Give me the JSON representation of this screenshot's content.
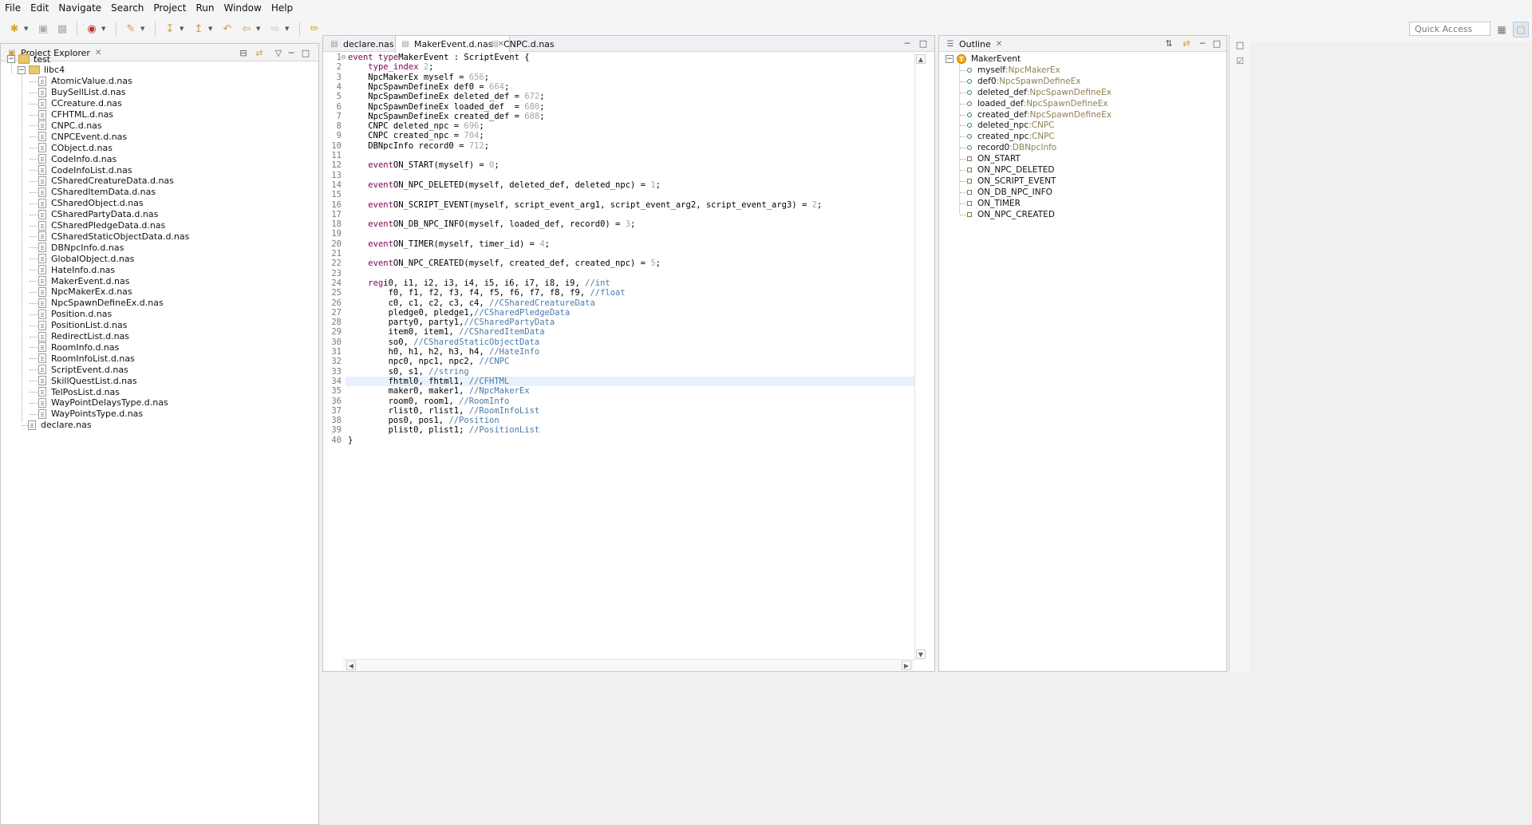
{
  "menu": [
    "File",
    "Edit",
    "Navigate",
    "Search",
    "Project",
    "Run",
    "Window",
    "Help"
  ],
  "toolbar": {
    "quick_access": "Quick Access",
    "icons": [
      "new-icon",
      "save-icon",
      "save-all-icon",
      "debug-icon",
      "run-icon",
      "build-icon",
      "search-icon",
      "back-icon",
      "forward-icon",
      "pin-icon"
    ]
  },
  "project_explorer": {
    "title": "Project Explorer",
    "project": "test",
    "folder": "libc4",
    "files": [
      "AtomicValue.d.nas",
      "BuySellList.d.nas",
      "CCreature.d.nas",
      "CFHTML.d.nas",
      "CNPC.d.nas",
      "CNPCEvent.d.nas",
      "CObject.d.nas",
      "CodeInfo.d.nas",
      "CodeInfoList.d.nas",
      "CSharedCreatureData.d.nas",
      "CSharedItemData.d.nas",
      "CSharedObject.d.nas",
      "CSharedPartyData.d.nas",
      "CSharedPledgeData.d.nas",
      "CSharedStaticObjectData.d.nas",
      "DBNpcInfo.d.nas",
      "GlobalObject.d.nas",
      "HateInfo.d.nas",
      "MakerEvent.d.nas",
      "NpcMakerEx.d.nas",
      "NpcSpawnDefineEx.d.nas",
      "Position.d.nas",
      "PositionList.d.nas",
      "RedirectList.d.nas",
      "RoomInfo.d.nas",
      "RoomInfoList.d.nas",
      "ScriptEvent.d.nas",
      "SkillQuestList.d.nas",
      "TelPosList.d.nas",
      "WayPointDelaysType.d.nas",
      "WayPointsType.d.nas"
    ],
    "root_file": "declare.nas"
  },
  "editor": {
    "tabs": [
      "declare.nas",
      "MakerEvent.d.nas",
      "CNPC.d.nas"
    ],
    "active_tab": "MakerEvent.d.nas",
    "highlighted_line": 34,
    "lines": [
      [
        [
          "kw",
          "event type"
        ],
        [
          "",
          "MakerEvent : ScriptEvent {"
        ]
      ],
      [
        [
          "",
          "    "
        ],
        [
          "kw",
          "type_index"
        ],
        [
          "",
          ""
        ],
        [
          "num",
          " 2"
        ],
        [
          "",
          ";"
        ]
      ],
      [
        [
          "",
          "    NpcMakerEx myself = "
        ],
        [
          "num",
          "656"
        ],
        [
          "",
          ";"
        ]
      ],
      [
        [
          "",
          "    NpcSpawnDefineEx def0 = "
        ],
        [
          "num",
          "664"
        ],
        [
          "",
          ";"
        ]
      ],
      [
        [
          "",
          "    NpcSpawnDefineEx deleted_def = "
        ],
        [
          "num",
          "672"
        ],
        [
          "",
          ";"
        ]
      ],
      [
        [
          "",
          "    NpcSpawnDefineEx loaded_def  = "
        ],
        [
          "num",
          "680"
        ],
        [
          "",
          ";"
        ]
      ],
      [
        [
          "",
          "    NpcSpawnDefineEx created_def = "
        ],
        [
          "num",
          "688"
        ],
        [
          "",
          ";"
        ]
      ],
      [
        [
          "",
          "    CNPC deleted_npc = "
        ],
        [
          "num",
          "696"
        ],
        [
          "",
          ";"
        ]
      ],
      [
        [
          "",
          "    CNPC created_npc = "
        ],
        [
          "num",
          "704"
        ],
        [
          "",
          ";"
        ]
      ],
      [
        [
          "",
          "    DBNpcInfo record0 = "
        ],
        [
          "num",
          "712"
        ],
        [
          "",
          ";"
        ]
      ],
      [],
      [
        [
          "",
          "    "
        ],
        [
          "kw",
          "event"
        ],
        [
          "",
          ""
        ],
        [
          "",
          "ON_START(myself) = "
        ],
        [
          "num",
          "0"
        ],
        [
          "",
          ";"
        ]
      ],
      [],
      [
        [
          "",
          "    "
        ],
        [
          "kw",
          "event"
        ],
        [
          "",
          ""
        ],
        [
          "",
          "ON_NPC_DELETED(myself, deleted_def, deleted_npc) = "
        ],
        [
          "num",
          "1"
        ],
        [
          "",
          ";"
        ]
      ],
      [],
      [
        [
          "",
          "    "
        ],
        [
          "kw",
          "event"
        ],
        [
          "",
          ""
        ],
        [
          "",
          "ON_SCRIPT_EVENT(myself, script_event_arg1, script_event_arg2, script_event_arg3) = "
        ],
        [
          "num",
          "2"
        ],
        [
          "",
          ";"
        ]
      ],
      [],
      [
        [
          "",
          "    "
        ],
        [
          "kw",
          "event"
        ],
        [
          "",
          ""
        ],
        [
          "",
          "ON_DB_NPC_INFO(myself, loaded_def, record0) = "
        ],
        [
          "num",
          "3"
        ],
        [
          "",
          ";"
        ]
      ],
      [],
      [
        [
          "",
          "    "
        ],
        [
          "kw",
          "event"
        ],
        [
          "",
          ""
        ],
        [
          "",
          "ON_TIMER(myself, timer_id) = "
        ],
        [
          "num",
          "4"
        ],
        [
          "",
          ";"
        ]
      ],
      [],
      [
        [
          "",
          "    "
        ],
        [
          "kw",
          "event"
        ],
        [
          "",
          ""
        ],
        [
          "",
          "ON_NPC_CREATED(myself, created_def, created_npc) = "
        ],
        [
          "num",
          "5"
        ],
        [
          "",
          ";"
        ]
      ],
      [],
      [
        [
          "",
          "    "
        ],
        [
          "kw",
          "reg"
        ],
        [
          "",
          ""
        ],
        [
          "",
          "i0, i1, i2, i3, i4, i5, i6, i7, i8, i9, "
        ],
        [
          "cm",
          "//int"
        ]
      ],
      [
        [
          "",
          "        f0, f1, f2, f3, f4, f5, f6, f7, f8, f9, "
        ],
        [
          "cm",
          "//float"
        ]
      ],
      [
        [
          "",
          "        c0, c1, c2, c3, c4, "
        ],
        [
          "cm",
          "//CSharedCreatureData"
        ]
      ],
      [
        [
          "",
          "        pledge0, pledge1,"
        ],
        [
          "cm",
          "//CSharedPledgeData"
        ]
      ],
      [
        [
          "",
          "        party0, party1,"
        ],
        [
          "cm",
          "//CSharedPartyData"
        ]
      ],
      [
        [
          "",
          "        item0, item1, "
        ],
        [
          "cm",
          "//CSharedItemData"
        ]
      ],
      [
        [
          "",
          "        so0, "
        ],
        [
          "cm",
          "//CSharedStaticObjectData"
        ]
      ],
      [
        [
          "",
          "        h0, h1, h2, h3, h4, "
        ],
        [
          "cm",
          "//HateInfo"
        ]
      ],
      [
        [
          "",
          "        npc0, npc1, npc2, "
        ],
        [
          "cm",
          "//CNPC"
        ]
      ],
      [
        [
          "",
          "        s0, s1, "
        ],
        [
          "cm",
          "//string"
        ]
      ],
      [
        [
          "",
          "        fhtml0, fhtml1, "
        ],
        [
          "cm",
          "//CFHTML"
        ]
      ],
      [
        [
          "",
          "        maker0, maker1, "
        ],
        [
          "cm",
          "//NpcMakerEx"
        ]
      ],
      [
        [
          "",
          "        room0, room1, "
        ],
        [
          "cm",
          "//RoomInfo"
        ]
      ],
      [
        [
          "",
          "        rlist0, rlist1, "
        ],
        [
          "cm",
          "//RoomInfoList"
        ]
      ],
      [
        [
          "",
          "        pos0, pos1, "
        ],
        [
          "cm",
          "//Position"
        ]
      ],
      [
        [
          "",
          "        plist0, plist1; "
        ],
        [
          "cm",
          "//PositionList"
        ]
      ],
      [
        [
          "",
          "}"
        ]
      ]
    ]
  },
  "outline": {
    "title": "Outline",
    "root": "MakerEvent",
    "fields": [
      {
        "name": "myself",
        "type": "NpcMakerEx"
      },
      {
        "name": "def0",
        "type": "NpcSpawnDefineEx"
      },
      {
        "name": "deleted_def",
        "type": "NpcSpawnDefineEx"
      },
      {
        "name": "loaded_def",
        "type": "NpcSpawnDefineEx"
      },
      {
        "name": "created_def",
        "type": "NpcSpawnDefineEx"
      },
      {
        "name": "deleted_npc",
        "type": "CNPC"
      },
      {
        "name": "created_npc",
        "type": "CNPC"
      },
      {
        "name": "record0",
        "type": "DBNpcInfo"
      }
    ],
    "events": [
      "ON_START",
      "ON_NPC_DELETED",
      "ON_SCRIPT_EVENT",
      "ON_DB_NPC_INFO",
      "ON_TIMER",
      "ON_NPC_CREATED"
    ]
  }
}
